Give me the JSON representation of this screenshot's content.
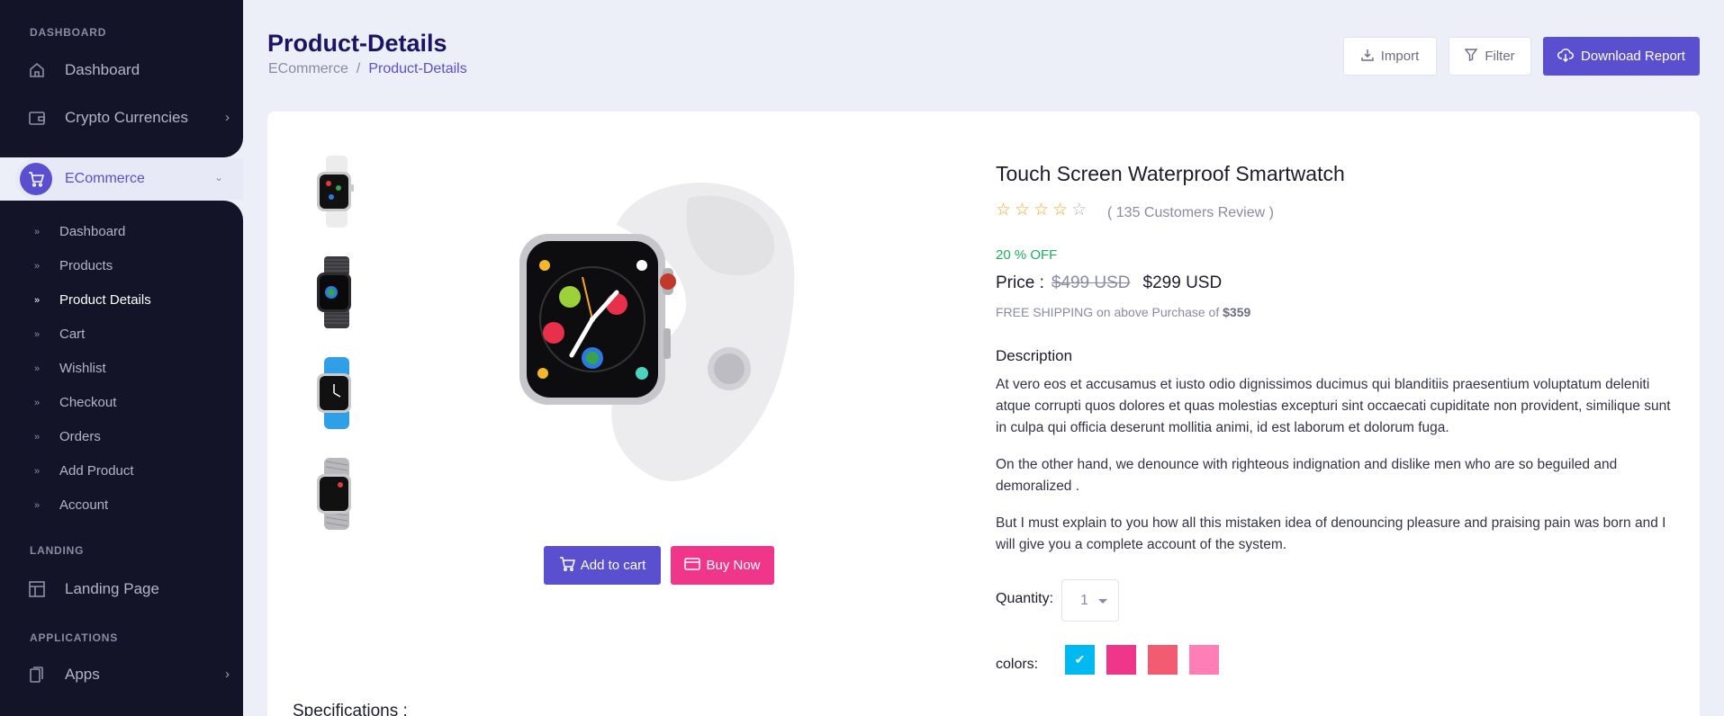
{
  "sidebar": {
    "sections": {
      "dashboard": "DASHBOARD",
      "landing": "LANDING",
      "applications": "APPLICATIONS"
    },
    "items": {
      "dashboard": "Dashboard",
      "crypto": "Crypto Currencies",
      "ecommerce": "ECommerce",
      "landing_page": "Landing Page",
      "apps": "Apps"
    },
    "ecommerce_sub": [
      {
        "label": "Dashboard",
        "active": false
      },
      {
        "label": "Products",
        "active": false
      },
      {
        "label": "Product Details",
        "active": true
      },
      {
        "label": "Cart",
        "active": false
      },
      {
        "label": "Wishlist",
        "active": false
      },
      {
        "label": "Checkout",
        "active": false
      },
      {
        "label": "Orders",
        "active": false
      },
      {
        "label": "Add Product",
        "active": false
      },
      {
        "label": "Account",
        "active": false
      }
    ]
  },
  "header": {
    "title": "Product-Details",
    "breadcrumb": [
      "ECommerce",
      "/",
      "Product-Details"
    ],
    "buttons": {
      "import": "Import",
      "filter": "Filter",
      "download": "Download Report"
    }
  },
  "product": {
    "title": "Touch Screen Waterproof Smartwatch",
    "rating": 4,
    "rating_max": 5,
    "reviews": "( 135 Customers Review )",
    "discount": "20 % OFF",
    "price_label": "Price :",
    "price_old": "$499 USD",
    "price_new": "$299 USD",
    "shipping_text": "FREE SHIPPING on above Purchase of",
    "shipping_amount": "$359",
    "description_title": "Description",
    "description": [
      "At vero eos et accusamus et iusto odio dignissimos ducimus qui blanditiis praesentium voluptatum deleniti atque corrupti quos dolores et quas molestias excepturi sint occaecati cupiditate non provident, similique sunt in culpa qui officia deserunt mollitia animi, id est laborum et dolorum fuga.",
      "On the other hand, we denounce with righteous indignation and dislike men who are so beguiled and demoralized .",
      "But I must explain to you how all this mistaken idea of denouncing pleasure and praising pain was born and I will give you a complete account of the system."
    ],
    "quantity_label": "Quantity:",
    "quantity_value": "1",
    "colors_label": "colors:",
    "colors": [
      "#00b9f1",
      "#f0368a",
      "#f35b73",
      "#ff7eb6"
    ],
    "selected_color_index": 0,
    "thumbnails": [
      "white-sport-band",
      "black-link-bracelet",
      "blue-sport-band",
      "grey-sport-loop"
    ],
    "actions": {
      "add_to_cart": "Add to cart",
      "buy_now": "Buy Now"
    },
    "specifications_title": "Specifications :"
  },
  "colors": {
    "primary": "#5a4fcf",
    "pink": "#f0368a",
    "sidebar_bg": "#141428",
    "success": "#1dae5f",
    "star": "#f5a623"
  }
}
